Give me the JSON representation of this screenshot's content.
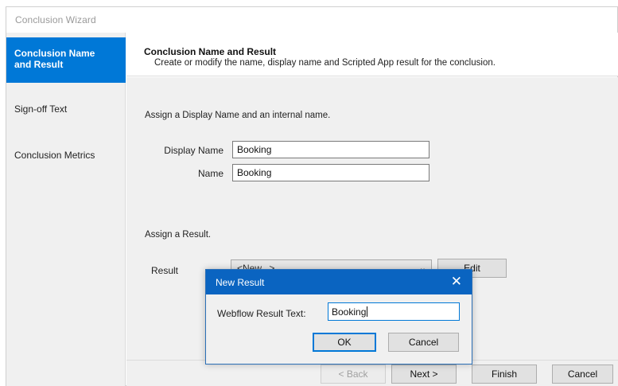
{
  "window": {
    "title": "Conclusion Wizard"
  },
  "sidebar": {
    "items": [
      {
        "label_line1": "Conclusion Name",
        "label_line2": "and Result",
        "active": true
      },
      {
        "label": "Sign-off Text",
        "active": false
      },
      {
        "label": "Conclusion Metrics",
        "active": false
      }
    ]
  },
  "header": {
    "title": "Conclusion Name and Result",
    "subtitle": "Create or modify the name, display name and Scripted App result for the conclusion."
  },
  "form": {
    "names_section_label": "Assign a Display Name and an internal name.",
    "display_name_label": "Display Name",
    "display_name_value": "Booking",
    "name_label": "Name",
    "name_value": "Booking",
    "result_section_label": "Assign a Result.",
    "result_label": "Result",
    "result_selected": "<New...>",
    "edit_button": "Edit"
  },
  "footer": {
    "back_button": "< Back",
    "next_button": "Next >",
    "finish_button": "Finish",
    "cancel_button": "Cancel"
  },
  "dialog": {
    "title": "New Result",
    "close_glyph": "✕",
    "field_label": "Webflow Result Text:",
    "field_value": "Booking",
    "ok_button": "OK",
    "cancel_button": "Cancel"
  },
  "colors": {
    "accent": "#0078d7",
    "dialog_titlebar": "#0a64c1",
    "panel_bg": "#f0f0f0"
  }
}
